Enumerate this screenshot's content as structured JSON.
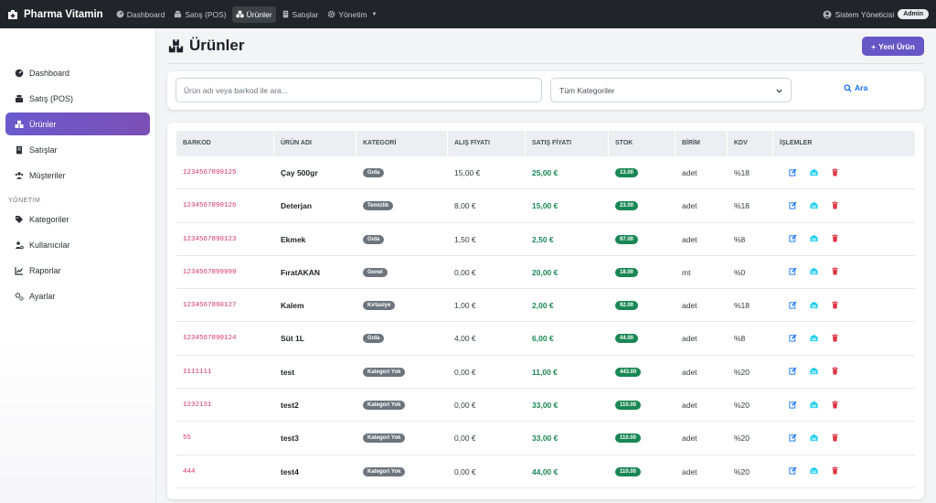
{
  "navbar": {
    "brand": "Pharma Vitamin",
    "items": [
      {
        "label": "Dashboard",
        "icon": "gauge-icon"
      },
      {
        "label": "Satış (POS)",
        "icon": "cash-register-icon"
      },
      {
        "label": "Ürünler",
        "icon": "boxes-icon"
      },
      {
        "label": "Satışlar",
        "icon": "receipt-icon"
      },
      {
        "label": "Yönetim",
        "icon": "gear-icon"
      }
    ],
    "user": "Sistem Yöneticisi",
    "role_badge": "Admin"
  },
  "sidebar": {
    "items": [
      {
        "label": "Dashboard"
      },
      {
        "label": "Satış (POS)"
      },
      {
        "label": "Ürünler"
      },
      {
        "label": "Satışlar"
      },
      {
        "label": "Müşteriler"
      }
    ],
    "section_title": "YÖNETİM",
    "admin_items": [
      {
        "label": "Kategoriler"
      },
      {
        "label": "Kullanıcılar"
      },
      {
        "label": "Raporlar"
      },
      {
        "label": "Ayarlar"
      }
    ]
  },
  "page": {
    "title": "Ürünler",
    "new_button": "Yeni Ürün"
  },
  "filters": {
    "search_placeholder": "Ürün adı veya barkod ile ara...",
    "category_selected": "Tüm Kategoriler",
    "search_button": "Ara"
  },
  "table": {
    "headers": [
      "BARKOD",
      "ÜRÜN ADI",
      "KATEGORİ",
      "ALIŞ FİYATI",
      "SATIŞ FİYATI",
      "STOK",
      "BİRİM",
      "KDV",
      "İŞLEMLER"
    ],
    "rows": [
      {
        "barcode": "1234567890125",
        "name": "Çay 500gr",
        "category": "Gıda",
        "buy": "15,00 €",
        "sell": "25,00 €",
        "stock": "13.00",
        "unit": "adet",
        "kdv": "%18"
      },
      {
        "barcode": "1234567890126",
        "name": "Deterjan",
        "category": "Temizlik",
        "buy": "8,00 €",
        "sell": "15,00 €",
        "stock": "23.00",
        "unit": "adet",
        "kdv": "%18"
      },
      {
        "barcode": "1234567890123",
        "name": "Ekmek",
        "category": "Gıda",
        "buy": "1,50 €",
        "sell": "2,50 €",
        "stock": "97.00",
        "unit": "adet",
        "kdv": "%8"
      },
      {
        "barcode": "1234567899999",
        "name": "FıratAKAN",
        "category": "Genel",
        "buy": "0,00 €",
        "sell": "20,00 €",
        "stock": "18.00",
        "unit": "mt",
        "kdv": "%0"
      },
      {
        "barcode": "1234567890127",
        "name": "Kalem",
        "category": "Kırtasiye",
        "buy": "1,00 €",
        "sell": "2,00 €",
        "stock": "92.00",
        "unit": "adet",
        "kdv": "%18"
      },
      {
        "barcode": "1234567890124",
        "name": "Süt 1L",
        "category": "Gıda",
        "buy": "4,00 €",
        "sell": "6,00 €",
        "stock": "44.00",
        "unit": "adet",
        "kdv": "%8"
      },
      {
        "barcode": "1111111",
        "name": "test",
        "category": "Kategori Yok",
        "buy": "0,00 €",
        "sell": "11,00 €",
        "stock": "443.00",
        "unit": "adet",
        "kdv": "%20"
      },
      {
        "barcode": "1232131",
        "name": "test2",
        "category": "Kategori Yok",
        "buy": "0,00 €",
        "sell": "33,00 €",
        "stock": "110.00",
        "unit": "adet",
        "kdv": "%20"
      },
      {
        "barcode": "55",
        "name": "test3",
        "category": "Kategori Yok",
        "buy": "0,00 €",
        "sell": "33,00 €",
        "stock": "110.00",
        "unit": "adet",
        "kdv": "%20"
      },
      {
        "barcode": "444",
        "name": "test4",
        "category": "Kategori Yok",
        "buy": "0,00 €",
        "sell": "44,00 €",
        "stock": "110.00",
        "unit": "adet",
        "kdv": "%20"
      }
    ]
  },
  "colors": {
    "accent": "#6657c7",
    "success": "#198754",
    "barcode": "#d6336c",
    "danger": "#dc3545",
    "info": "#0dcaf0",
    "primary": "#0d6efd"
  }
}
